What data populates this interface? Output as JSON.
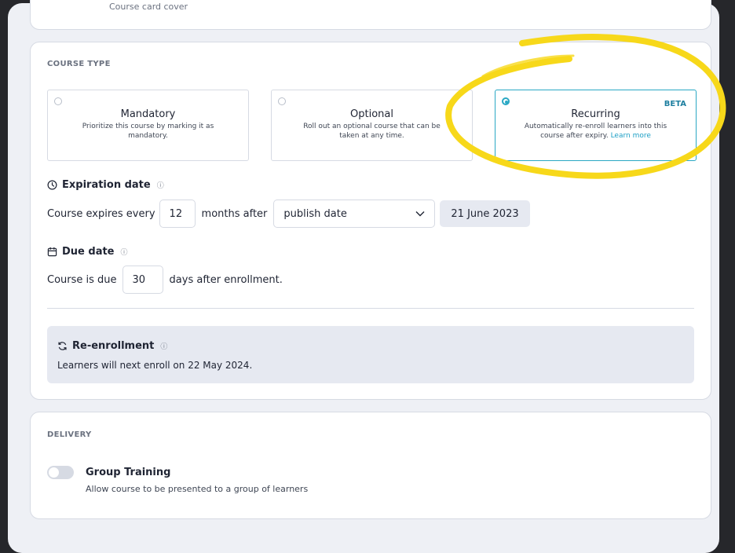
{
  "top_card": {
    "cover_label": "Course card cover"
  },
  "course_type": {
    "section_label": "COURSE TYPE",
    "options": [
      {
        "title": "Mandatory",
        "description": "Prioritize this course by marking it as mandatory.",
        "selected": false
      },
      {
        "title": "Optional",
        "description": "Roll out an optional course that can be taken at any time.",
        "selected": false
      },
      {
        "title": "Recurring",
        "description": "Automatically re-enroll learners into this course after expiry.",
        "link": "Learn more",
        "badge": "BETA",
        "selected": true
      }
    ]
  },
  "expiration": {
    "heading": "Expiration date",
    "prefix": "Course expires every",
    "months_value": "12",
    "middle": "months after",
    "trigger_selected": "publish date",
    "date_chip": "21 June 2023"
  },
  "due": {
    "heading": "Due date",
    "prefix": "Course is due",
    "days_value": "30",
    "suffix": "days after enrollment."
  },
  "reenrollment": {
    "heading": "Re-enrollment",
    "text": "Learners will next enroll on 22 May 2024."
  },
  "delivery": {
    "section_label": "DELIVERY",
    "group_training_label": "Group Training",
    "group_training_desc": "Allow course to be presented to a group of learners",
    "group_training_enabled": false
  },
  "colors": {
    "accent": "#2aa8c4",
    "highlight": "#f7d81a"
  },
  "icons": {
    "expiration": "clock-icon",
    "due": "calendar-icon",
    "reenroll": "refresh-icon",
    "info": "info-icon",
    "chevron": "chevron-down-icon"
  }
}
